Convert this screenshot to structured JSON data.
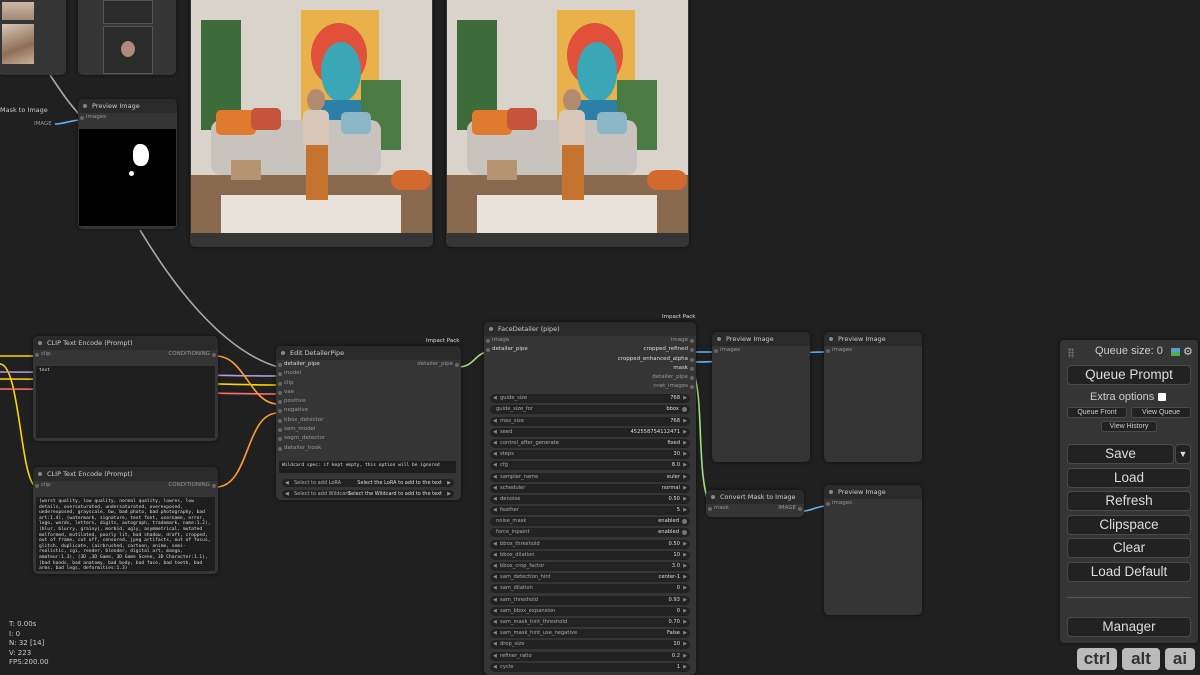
{
  "stats": {
    "t": "T: 0.00s",
    "i": "I: 0",
    "n": "N: 32 [14]",
    "v": "V: 223",
    "fps": "FPS:200.00"
  },
  "mask_to_image_top": {
    "title": "Mask to Image",
    "out": "IMAGE"
  },
  "preview_top": {
    "title": "Preview Image",
    "in": "images"
  },
  "clip1": {
    "title": "CLIP Text Encode (Prompt)",
    "in": "clip",
    "out": "CONDITIONING",
    "text": "text"
  },
  "clip2": {
    "title": "CLIP Text Encode (Prompt)",
    "in": "clip",
    "out": "CONDITIONING",
    "text": "(worst quality, low quality, normal quality, lowres, low details, oversaturated, undersaturated, overexposed, underexposed, grayscale, bw, bad photo, bad photography, bad art:1.4), (watermark, signature, text font, username, error, logo, words, letters, digits, autograph, trademark, name:1.2), (blur, blurry, grainy), morbid, ugly, asymmetrical, mutated malformed, mutilated, poorly lit, bad shadow, draft, cropped, out of frame, cut off, censored, jpeg artifacts, out of focus, glitch, duplicate, (airbrushed, cartoon, anime, semi-realistic, cgi, render, blender, digital art, manga, amateur:1.3), (3D ,3D Game, 3D Game Scene, 3D Character:1.1), (bad hands, bad anatomy, bad body, bad face, bad teeth, bad arms, bad legs, deformities:1.3)"
  },
  "edit_detailer": {
    "title": "Edit DetailerPipe",
    "badge": "Impact Pack",
    "inputs": [
      "detailer_pipe",
      "model",
      "clip",
      "vae",
      "positive",
      "negative",
      "bbox_detector",
      "sam_model",
      "segm_detector",
      "detailer_hook"
    ],
    "output": "detailer_pipe",
    "wildcard": "Wildcard spec: if kept empty, this option will be ignored",
    "lora_left": "Select to add LoRA",
    "lora_right": "Select the LoRA to add to the text",
    "wc_left": "Select to add Wildcard",
    "wc_right": "Select the Wildcard to add to the text"
  },
  "face_detailer": {
    "title": "FaceDetailer (pipe)",
    "badge": "Impact Pack",
    "in_image": "image",
    "in_pipe": "detailer_pipe",
    "outputs": [
      "image",
      "cropped_refined",
      "cropped_enhanced_alpha",
      "mask",
      "detailer_pipe",
      "cnet_images"
    ],
    "widgets": [
      {
        "l": "guide_size",
        "v": "768",
        "t": "num"
      },
      {
        "l": "guide_size_for",
        "v": "bbox",
        "t": "tog"
      },
      {
        "l": "max_size",
        "v": "768",
        "t": "num"
      },
      {
        "l": "seed",
        "v": "452558754112471",
        "t": "num"
      },
      {
        "l": "control_after_generate",
        "v": "fixed",
        "t": "num"
      },
      {
        "l": "steps",
        "v": "30",
        "t": "num"
      },
      {
        "l": "cfg",
        "v": "8.0",
        "t": "num"
      },
      {
        "l": "sampler_name",
        "v": "euler",
        "t": "num"
      },
      {
        "l": "scheduler",
        "v": "normal",
        "t": "num"
      },
      {
        "l": "denoise",
        "v": "0.50",
        "t": "num"
      },
      {
        "l": "feather",
        "v": "5",
        "t": "num"
      },
      {
        "l": "noise_mask",
        "v": "enabled",
        "t": "tog"
      },
      {
        "l": "force_inpaint",
        "v": "enabled",
        "t": "tog"
      },
      {
        "l": "bbox_threshold",
        "v": "0.50",
        "t": "num"
      },
      {
        "l": "bbox_dilation",
        "v": "10",
        "t": "num"
      },
      {
        "l": "bbox_crop_factor",
        "v": "3.0",
        "t": "num"
      },
      {
        "l": "sam_detection_hint",
        "v": "center-1",
        "t": "num"
      },
      {
        "l": "sam_dilation",
        "v": "0",
        "t": "num"
      },
      {
        "l": "sam_threshold",
        "v": "0.93",
        "t": "num"
      },
      {
        "l": "sam_bbox_expansion",
        "v": "0",
        "t": "num"
      },
      {
        "l": "sam_mask_hint_threshold",
        "v": "0.70",
        "t": "num"
      },
      {
        "l": "sam_mask_hint_use_negative",
        "v": "False",
        "t": "num"
      },
      {
        "l": "drop_size",
        "v": "10",
        "t": "num"
      },
      {
        "l": "refiner_ratio",
        "v": "0.2",
        "t": "num"
      },
      {
        "l": "cycle",
        "v": "1",
        "t": "num"
      }
    ]
  },
  "preview_a": {
    "title": "Preview Image",
    "in": "images"
  },
  "preview_b": {
    "title": "Preview Image",
    "in": "images"
  },
  "preview_c": {
    "title": "Preview Image",
    "in": "images"
  },
  "convert_mask": {
    "title": "Convert Mask to Image",
    "in": "mask",
    "out": "IMAGE"
  },
  "menu": {
    "queue_size": "Queue size: 0",
    "queue_prompt": "Queue Prompt",
    "extra_options": "Extra options",
    "queue_front": "Queue Front",
    "view_queue": "View Queue",
    "view_history": "View History",
    "save": "Save",
    "save_arrow": "▼",
    "load": "Load",
    "refresh": "Refresh",
    "clipspace": "Clipspace",
    "clear": "Clear",
    "load_default": "Load Default",
    "manager": "Manager"
  },
  "keys": {
    "ctrl": "ctrl",
    "alt": "alt",
    "ai": "ai"
  },
  "colors": {
    "canvas": "#202020",
    "node": "#353535",
    "title": "#2a2a2a",
    "link_clip": "#ffd500",
    "link_cond": "#ff9c35",
    "link_model": "#b39ddb",
    "link_vae": "#ff6e6e",
    "link_pipe": "#a1e27e",
    "link_image": "#64b5f6",
    "link_gray": "#aaaaaa"
  }
}
